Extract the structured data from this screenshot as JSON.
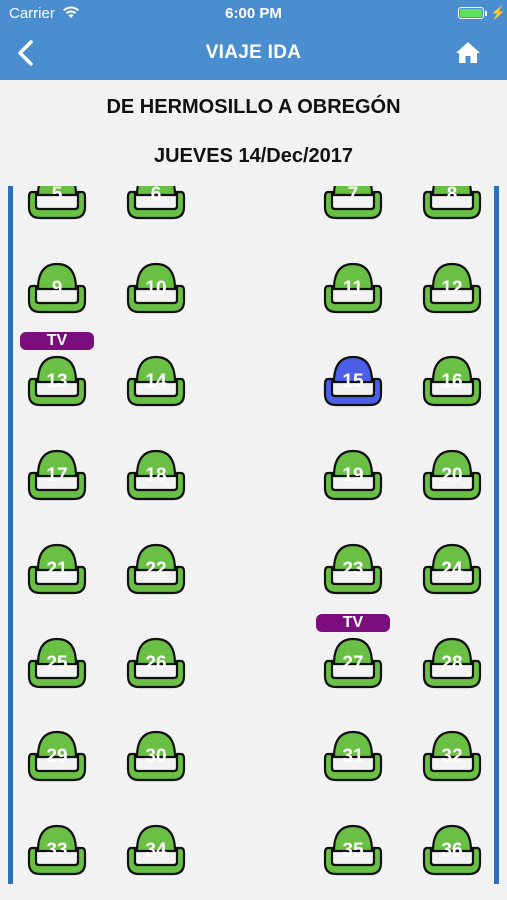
{
  "status_bar": {
    "carrier": "Carrier",
    "time": "6:00 PM"
  },
  "nav": {
    "title": "VIAJE IDA",
    "back_icon": "chevron-left-icon",
    "home_icon": "home-icon"
  },
  "trip": {
    "route": "DE HERMOSILLO A OBREGÓN",
    "date": "JUEVES 14/Dec/2017"
  },
  "colors": {
    "header": "#4a8ed0",
    "seat_available": "#6abf45",
    "seat_selected": "#4d5ee8",
    "tv_badge": "#7b0d7e",
    "wall": "#2f6fb5"
  },
  "tv_label": "TV",
  "rows": [
    [
      {
        "number": "5"
      },
      {
        "number": "6"
      },
      {
        "number": "7"
      },
      {
        "number": "8"
      }
    ],
    [
      {
        "number": "9"
      },
      {
        "number": "10"
      },
      {
        "number": "11"
      },
      {
        "number": "12"
      }
    ],
    [
      {
        "number": "13",
        "tv": true
      },
      {
        "number": "14"
      },
      {
        "number": "15",
        "selected": true
      },
      {
        "number": "16"
      }
    ],
    [
      {
        "number": "17"
      },
      {
        "number": "18"
      },
      {
        "number": "19"
      },
      {
        "number": "20"
      }
    ],
    [
      {
        "number": "21"
      },
      {
        "number": "22"
      },
      {
        "number": "23"
      },
      {
        "number": "24"
      }
    ],
    [
      {
        "number": "25"
      },
      {
        "number": "26"
      },
      {
        "number": "27",
        "tv": true
      },
      {
        "number": "28"
      }
    ],
    [
      {
        "number": "29"
      },
      {
        "number": "30"
      },
      {
        "number": "31"
      },
      {
        "number": "32"
      }
    ],
    [
      {
        "number": "33"
      },
      {
        "number": "34"
      },
      {
        "number": "35"
      },
      {
        "number": "36"
      }
    ]
  ]
}
